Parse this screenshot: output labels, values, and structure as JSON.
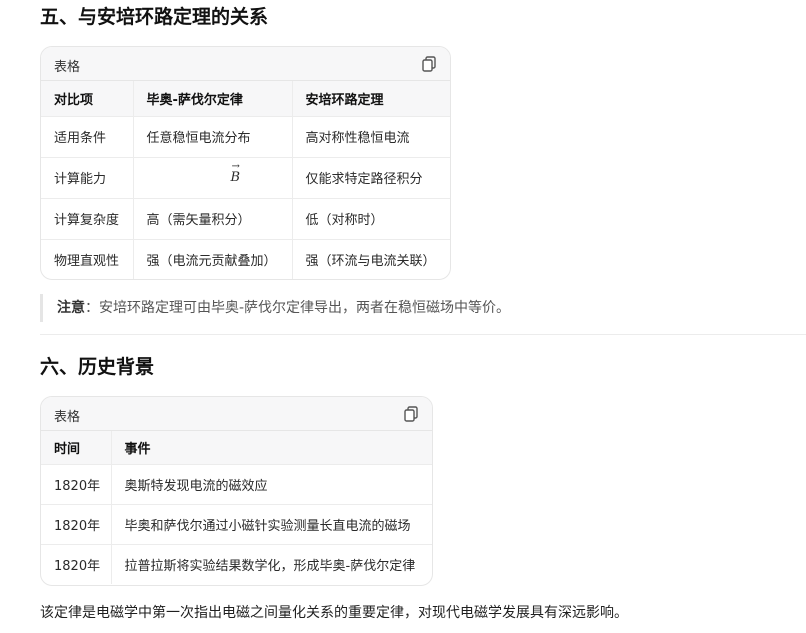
{
  "section5": {
    "title": "五、与安培环路定理的关系",
    "table_label": "表格",
    "headers": [
      "对比项",
      "毕奥-萨伐尔定律",
      "安培环路定理"
    ],
    "rows": [
      [
        "适用条件",
        "任意稳恒电流分布",
        "高对称性稳恒电流"
      ],
      [
        "计算能力",
        "B",
        "仅能求特定路径积分"
      ],
      [
        "计算复杂度",
        "高（需矢量积分）",
        "低（对称时）"
      ],
      [
        "物理直观性",
        "强（电流元贡献叠加）",
        "强（环流与电流关联）"
      ]
    ],
    "note_label": "注意",
    "note_text": "：安培环路定理可由毕奥-萨伐尔定律导出，两者在稳恒磁场中等价。"
  },
  "section6": {
    "title": "六、历史背景",
    "table_label": "表格",
    "headers": [
      "时间",
      "事件"
    ],
    "rows": [
      [
        "1820年",
        "奥斯特发现电流的磁效应"
      ],
      [
        "1820年",
        "毕奥和萨伐尔通过小磁针实验测量长直电流的磁场"
      ],
      [
        "1820年",
        "拉普拉斯将实验结果数学化，形成毕奥-萨伐尔定律"
      ]
    ]
  },
  "footer_text": "该定律是电磁学中第一次指出电磁之间量化关系的重要定律，对现代电磁学发展具有深远影响。",
  "icons": {
    "copy": "copy-icon"
  }
}
